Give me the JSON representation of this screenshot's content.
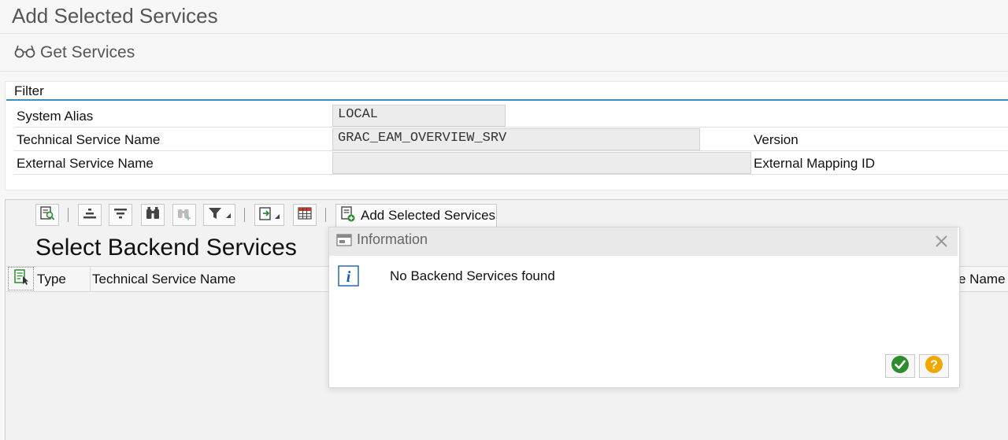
{
  "page": {
    "title": "Add Selected Services"
  },
  "toolbar": {
    "get_services_label": "Get Services",
    "get_services_icon": "glasses-icon"
  },
  "filter": {
    "title": "Filter",
    "system_alias_label": "System Alias",
    "system_alias_value": "LOCAL",
    "technical_service_name_label": "Technical Service Name",
    "technical_service_name_value": "GRAC_EAM_OVERVIEW_SRV",
    "version_label": "Version",
    "external_service_name_label": "External Service Name",
    "external_service_name_value": "",
    "external_mapping_id_label": "External Mapping ID"
  },
  "grid": {
    "add_selected_services_label": "Add Selected Services",
    "title": "Select Backend Services",
    "columns": [
      "Type",
      "Technical Service Name"
    ],
    "partial_column": "e Name",
    "toolbar_icons": [
      "details-icon",
      "sort-ascending-icon",
      "sort-descending-icon",
      "find-icon",
      "find-next-icon",
      "filter-icon",
      "export-icon",
      "layout-icon"
    ]
  },
  "dialog": {
    "title": "Information",
    "message": "No Backend Services found",
    "ok_icon": "check-icon",
    "help_icon": "help-icon",
    "close_icon": "close-icon"
  },
  "colors": {
    "accent_line": "#3a8fbf",
    "ok_green": "#2e8b2e",
    "help_orange": "#f0a800",
    "info_blue": "#1b5fa8"
  }
}
